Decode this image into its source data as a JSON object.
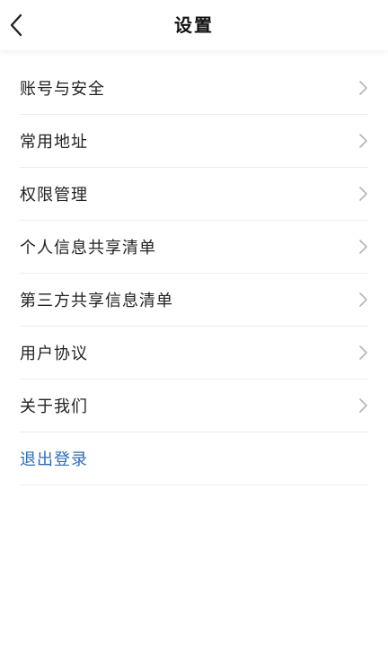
{
  "header": {
    "title": "设置"
  },
  "menu": {
    "items": [
      {
        "label": "账号与安全"
      },
      {
        "label": "常用地址"
      },
      {
        "label": "权限管理"
      },
      {
        "label": "个人信息共享清单"
      },
      {
        "label": "第三方共享信息清单"
      },
      {
        "label": "用户协议"
      },
      {
        "label": "关于我们"
      }
    ]
  },
  "logout": {
    "label": "退出登录"
  },
  "colors": {
    "logout_text": "#2f6db5",
    "chevron": "#b5b5b5",
    "divider": "#ececec"
  },
  "icons": {
    "back": "chevron-left-icon",
    "row_arrow": "chevron-right-icon"
  }
}
